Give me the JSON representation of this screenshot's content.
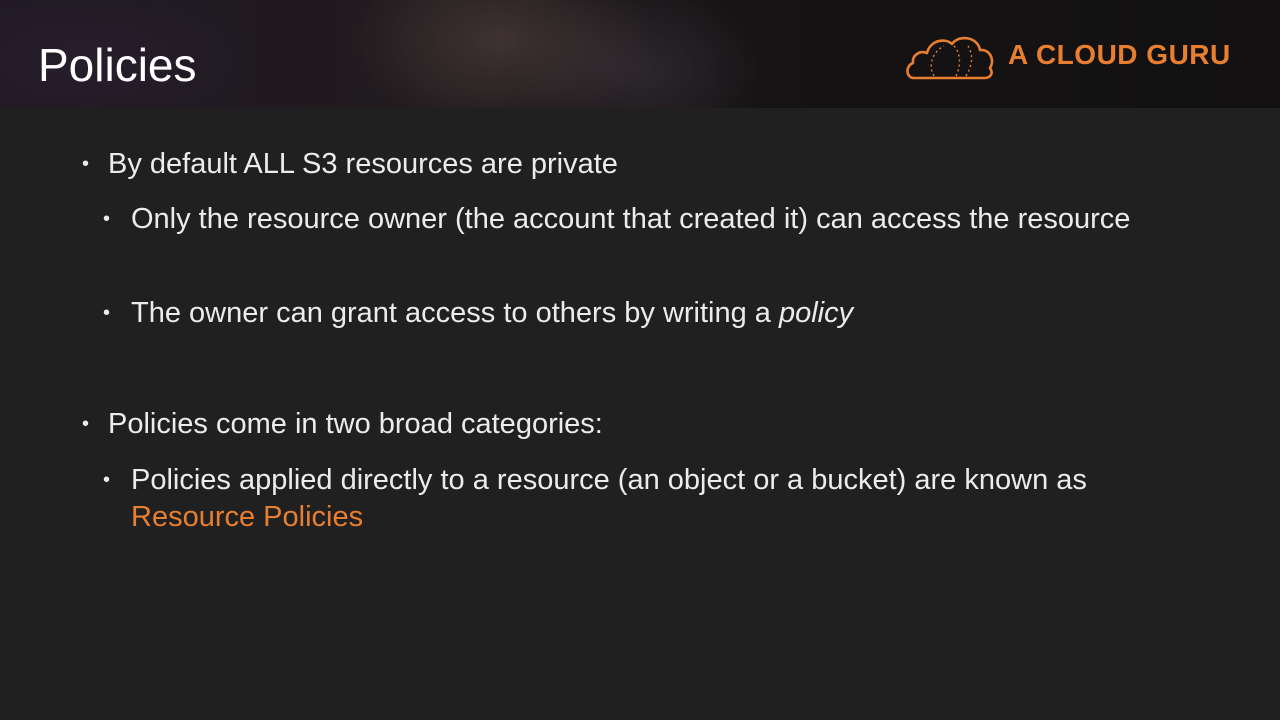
{
  "slide": {
    "title": "Policies",
    "brand": {
      "name": "A CLOUD GURU",
      "icon": "cloud-logo-icon",
      "color": "#e87f30"
    },
    "bullets": [
      {
        "text": "By default ALL S3 resources are private"
      },
      {
        "text": "Only the resource owner (the account that created it) can access the resource"
      },
      {
        "text_before": "The owner can grant access to others by writing a ",
        "emphasis": "policy"
      },
      {
        "text": "Policies come in two broad categories:"
      },
      {
        "text_before": "Policies applied directly to a resource (an object or a bucket) are known as ",
        "highlight": "Resource Policies"
      }
    ],
    "bullet_glyph": "•",
    "colors": {
      "background": "#202020",
      "text": "#ececec",
      "accent": "#e87f30"
    }
  }
}
